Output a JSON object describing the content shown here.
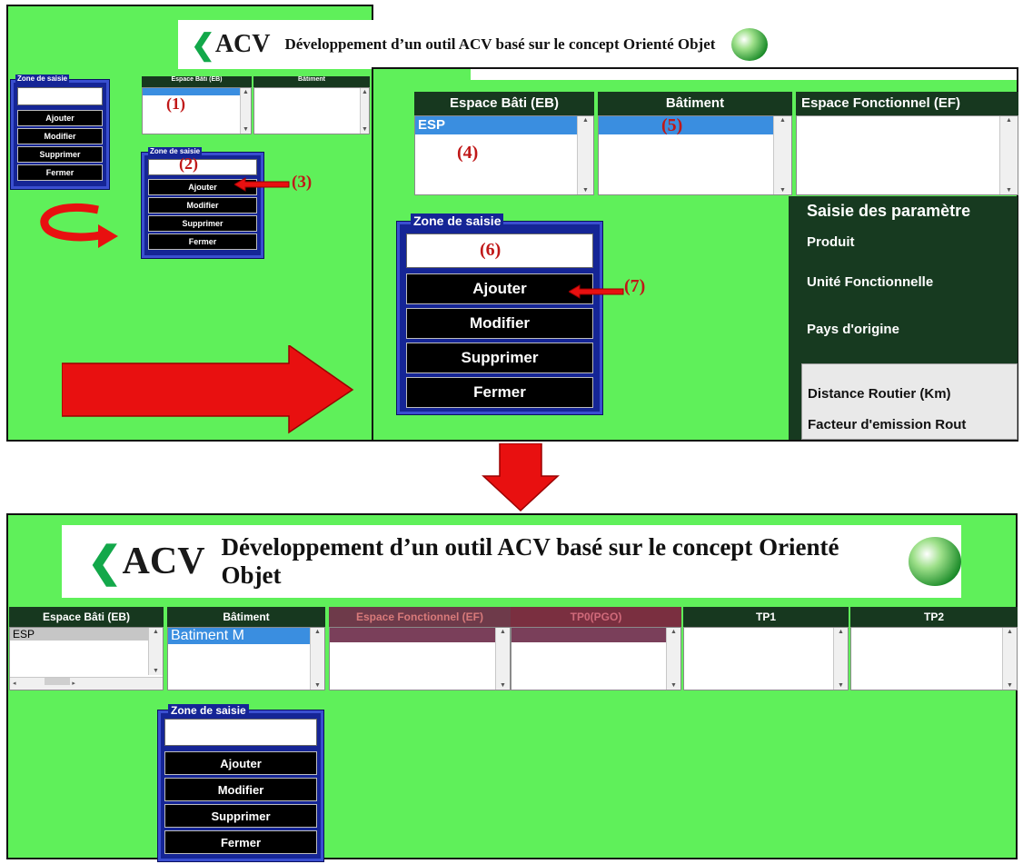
{
  "app": {
    "logo": "ACV",
    "title": "Développement d’un outil ACV basé sur le concept Orienté Objet"
  },
  "zone": {
    "title": "Zone de saisie",
    "buttons": [
      "Ajouter",
      "Modifier",
      "Supprimer",
      "Fermer"
    ]
  },
  "columns": {
    "eb": "Espace Bâti (EB)",
    "bat": "Bâtiment",
    "ef": "Espace Fonctionnel (EF)",
    "tp0": "TP0(PGO)",
    "tp1": "TP1",
    "tp2": "TP2"
  },
  "values": {
    "esp": "ESP",
    "batiment": "Batiment M"
  },
  "markers": {
    "m1": "(1)",
    "m2": "(2)",
    "m3": "(3)",
    "m4": "(4)",
    "m5": "(5)",
    "m6": "(6)",
    "m7": "(7)"
  },
  "params": {
    "title": "Saisie des paramètre",
    "produit": "Produit",
    "unite": "Unité Fonctionnelle",
    "pays": "Pays d'origine",
    "distance": "Distance Routier (Km)",
    "facteur": "Facteur d'emission Rout"
  },
  "colors": {
    "background": "#5ff05a",
    "zone": "#152596",
    "header": "#17381f",
    "selection": "#3a8ee0",
    "arrow": "#e81010"
  }
}
